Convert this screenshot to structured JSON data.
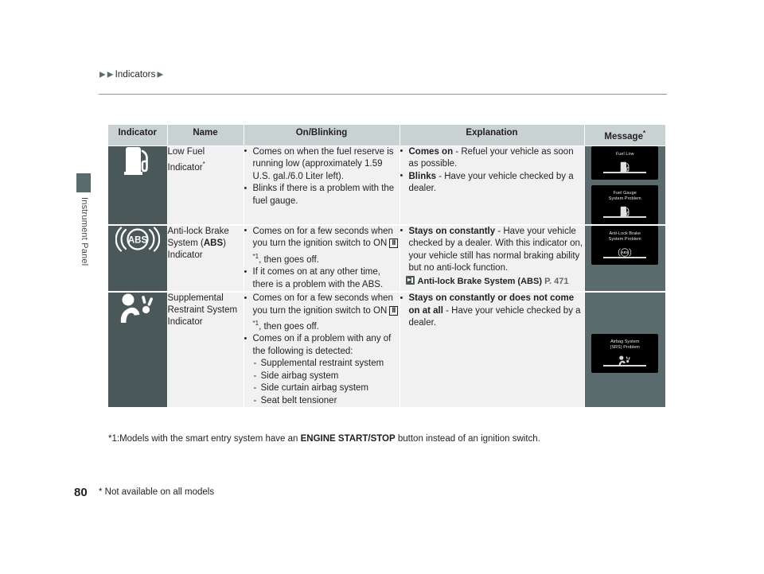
{
  "breadcrumb": {
    "arrow": "▶",
    "label": "Indicators"
  },
  "side_tab": {
    "label": "Instrument Panel"
  },
  "table": {
    "headers": {
      "indicator": "Indicator",
      "name": "Name",
      "on_blinking": "On/Blinking",
      "explanation": "Explanation",
      "message": "Message",
      "message_asterisk": "*"
    },
    "rows": [
      {
        "icon_name": "fuel-pump-icon",
        "name": "Low Fuel Indicator",
        "name_asterisk": "*",
        "on_blinking": [
          "Comes on when the fuel reserve is running low (approximately 1.59 U.S. gal./6.0 Liter left).",
          "Blinks if there is a problem with the fuel gauge."
        ],
        "explanation": [
          {
            "bold": "Comes on",
            "rest": " - Refuel your vehicle as soon as possible."
          },
          {
            "bold": "Blinks",
            "rest": " - Have your vehicle checked by a dealer."
          }
        ],
        "messages": [
          {
            "text": "Fuel Low",
            "glyph": "fuel-pump-icon"
          },
          {
            "text": "Fuel Gauge\nSystem Problem",
            "glyph": "fuel-pump-icon"
          }
        ]
      },
      {
        "icon_name": "abs-icon",
        "icon_text": "ABS",
        "name_pre": "Anti-lock Brake System (",
        "name_bold": "ABS",
        "name_post": ") Indicator",
        "on_blinking_1_pre": "Comes on for a few seconds when you turn the ignition switch to ON ",
        "on_blinking_1_box": "II",
        "on_blinking_1_fn": "*1",
        "on_blinking_1_post": ", then goes off.",
        "on_blinking_2": "If it comes on at any other time, there is a problem with the ABS.",
        "explanation": [
          {
            "bold": "Stays on constantly",
            "rest": " - Have your vehicle checked by a dealer. With this indicator on, your vehicle still has normal braking ability but no anti-lock function."
          }
        ],
        "xref_title": "Anti-lock Brake System (ABS)",
        "xref_page": "P. 471",
        "messages": [
          {
            "text": "Anti-Lock Brake\nSystem Problem",
            "glyph": "abs-icon"
          }
        ]
      },
      {
        "icon_name": "srs-airbag-icon",
        "name": "Supplemental Restraint System Indicator",
        "on_blinking_1_pre": "Comes on for a few seconds when you turn the ignition switch to ON ",
        "on_blinking_1_box": "II",
        "on_blinking_1_fn": "*1",
        "on_blinking_1_post": ", then goes off.",
        "on_blinking_2": "Comes on if a problem with any of the following is detected:",
        "sub_items": [
          "Supplemental restraint system",
          "Side airbag system",
          "Side curtain airbag system",
          "Seat belt tensioner"
        ],
        "explanation": [
          {
            "bold": "Stays on constantly or does not come on at all",
            "rest": " - Have your vehicle checked by a dealer."
          }
        ],
        "messages": [
          {
            "text": "Airbag System\n(SRS) Problem",
            "glyph": "srs-airbag-icon"
          }
        ]
      }
    ]
  },
  "footnote": {
    "prefix": "*1:Models with the smart entry system have an ",
    "bold": "ENGINE START/STOP",
    "suffix": " button instead of an ignition switch."
  },
  "footer": {
    "page_number": "80",
    "note": "* Not available on all models"
  },
  "colors": {
    "indicator_cell_bg": "#4b585a",
    "message_cell_bg": "#5a6a6d",
    "header_bg": "#c9d2d3",
    "body_cell_bg": "#f1f1f1",
    "screen_bg": "#000000"
  }
}
